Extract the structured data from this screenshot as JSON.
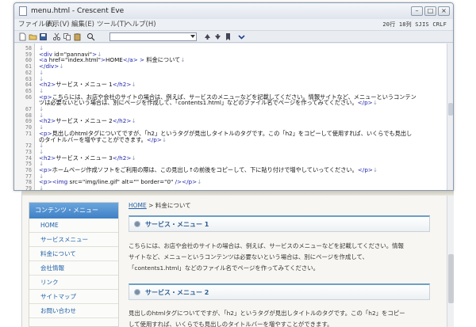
{
  "window": {
    "title": "menu.html - Crescent Eve",
    "min_label": "–",
    "max_label": "□",
    "close_label": "×"
  },
  "menu": {
    "items": [
      "ファイル(F)",
      "表示(V)",
      "編集(E)",
      "ツール(T)",
      "ヘルプ(H)"
    ],
    "status_right": "20行 18列 SJIS CRLF"
  },
  "toolbar": {
    "icons": [
      "new-file-icon",
      "open-folder-icon",
      "save-icon",
      "cut-icon",
      "copy-icon",
      "paste-icon",
      "find-icon",
      "arrow-up-icon",
      "arrow-down-icon",
      "bookmark-icon",
      "chevron-down-icon"
    ]
  },
  "editor": {
    "lines": [
      {
        "n": "58",
        "t": "↓"
      },
      {
        "n": "59",
        "t": "<div id=\"pannavi\">↓"
      },
      {
        "n": "60",
        "t": "<a href=\"index.html\">HOME</a> > 料金について↓"
      },
      {
        "n": "61",
        "t": "</div>↓"
      },
      {
        "n": "62",
        "t": "↓"
      },
      {
        "n": "63",
        "t": "↓"
      },
      {
        "n": "64",
        "t": "<h2>サービス・メニュー 1</h2>↓"
      },
      {
        "n": "65",
        "t": "↓"
      },
      {
        "n": "66",
        "t": "<p>こちらには、お店や会社のサイトの場合は、例えば、サービスのメニューなどを記載してください。情報サイトなど、メニューというコンテン"
      },
      {
        "n": "",
        "t": "ツは必要ないという場合は、別にページを作成して、「contents1.html」などのファイル名でページを作ってみてください。</p>↓"
      },
      {
        "n": "67",
        "t": "↓"
      },
      {
        "n": "68",
        "t": "↓"
      },
      {
        "n": "69",
        "t": "<h2>サービス・メニュー 2</h2>↓"
      },
      {
        "n": "70",
        "t": "↓"
      },
      {
        "n": "71",
        "t": "<p>見出しのhtmlタグについてですが、「h2」というタグが見出しタイトルのタグです。この「h2」をコピーして使用すれば、いくらでも見出し"
      },
      {
        "n": "",
        "t": "のタイトルバーを増やすことができます。</p>↓"
      },
      {
        "n": "72",
        "t": "↓"
      },
      {
        "n": "73",
        "t": "↓"
      },
      {
        "n": "74",
        "t": "<h2>サービス・メニュー 3</h2>↓"
      },
      {
        "n": "75",
        "t": "↓"
      },
      {
        "n": "76",
        "t": "<p>ホームページ作成ソフトをご利用の際は、この見出し↑の前後をコピーして、下に貼り付けで増やしていってください。</p>↓"
      },
      {
        "n": "77",
        "t": "↓"
      },
      {
        "n": "78",
        "t": "<p><img src=\"img/line.gif\" alt=\"\" border=\"0\" /></p>↓"
      },
      {
        "n": "79",
        "t": "↓"
      }
    ]
  },
  "preview": {
    "sidenav_title": "コンテンツ・メニュー",
    "sidenav_items": [
      "HOME",
      "サービスメニュー",
      "料金について",
      "会社情報",
      "リンク",
      "サイトマップ",
      "お問い合わせ"
    ],
    "breadcrumb_home": "HOME",
    "breadcrumb_rest": " > 料金について",
    "h2_1": "サービス・メニュー 1",
    "p1_line1": "こちらには、お店や会社のサイトの場合は、例えば、サービスのメニューなどを記載してください。情報",
    "p1_line2": "サイトなど、メニューというコンテンツは必要ないという場合は、別にページを作成して、",
    "p1_line3": "「contents1.html」などのファイル名でページを作ってみてください。",
    "h2_2": "サービス・メニュー 2",
    "p2_line1": "見出しのhtmlタグについてですが、「h2」というタグが見出しタイトルのタグです。この「h2」をコピー",
    "p2_line2": "して使用すれば、いくらでも見出しのタイトルバーを増やすことができます。"
  }
}
